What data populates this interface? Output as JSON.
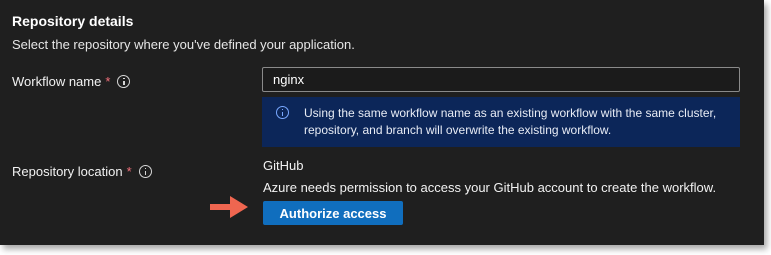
{
  "section": {
    "title": "Repository details",
    "description": "Select the repository where you've defined your application."
  },
  "workflow": {
    "label": "Workflow name",
    "required_marker": "*",
    "value": "nginx",
    "info_message": "Using the same workflow name as an existing workflow with the same cluster, repository, and branch will overwrite the existing workflow."
  },
  "repository_location": {
    "label": "Repository location",
    "required_marker": "*",
    "provider": "GitHub",
    "permission_text": "Azure needs permission to access your GitHub account to create the workflow.",
    "authorize_label": "Authorize access"
  },
  "icons": {
    "info": "info-icon",
    "callout": "arrow-right-icon"
  },
  "colors": {
    "panel_background": "#1f1f1f",
    "required_asterisk": "#f1707b",
    "info_box_background": "#0c2659",
    "info_box_icon": "#79a8ff",
    "primary_button": "#106ebe",
    "callout_arrow": "#ef6650"
  }
}
